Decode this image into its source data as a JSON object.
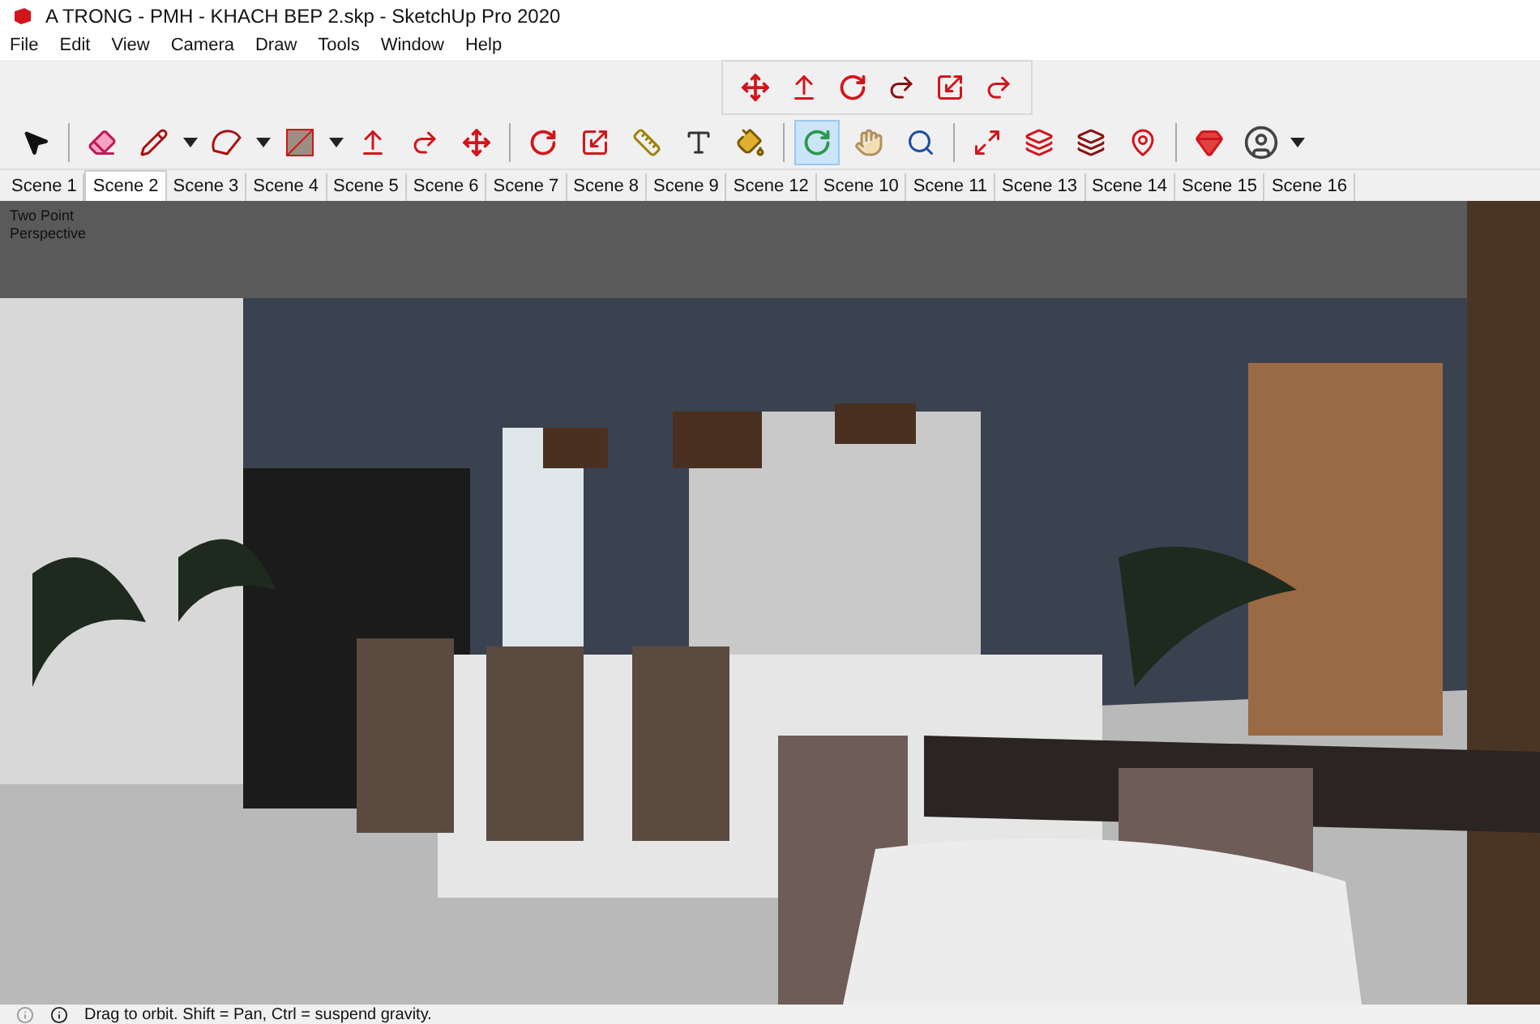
{
  "window": {
    "title": "A TRONG - PMH - KHACH BEP 2.skp - SketchUp Pro 2020"
  },
  "menu": [
    "File",
    "Edit",
    "View",
    "Camera",
    "Draw",
    "Tools",
    "Window",
    "Help"
  ],
  "floating_toolbar": [
    {
      "selected": false
    },
    {
      "selected": false
    },
    {
      "selected": false
    },
    {
      "selected": false
    },
    {
      "selected": false
    },
    {
      "selected": false
    }
  ],
  "main_toolbar": [
    {
      "selected": false
    },
    {
      "selected": false
    },
    {
      "selected": false
    },
    {
      "selected": false
    },
    {
      "selected": false
    },
    {
      "selected": false
    },
    {
      "selected": false
    },
    {
      "selected": false
    },
    {
      "selected": false
    },
    {
      "selected": false
    },
    {
      "selected": false
    },
    {
      "selected": false
    },
    {
      "selected": false
    },
    {
      "selected": true
    },
    {
      "selected": false
    },
    {
      "selected": false
    },
    {
      "selected": false
    },
    {
      "selected": false
    },
    {
      "selected": false
    },
    {
      "selected": false
    },
    {
      "selected": false
    },
    {
      "selected": false
    }
  ],
  "scenes": [
    {
      "label": "Scene 1",
      "selected": false
    },
    {
      "label": "Scene 2",
      "selected": true
    },
    {
      "label": "Scene 3",
      "selected": false
    },
    {
      "label": "Scene 4",
      "selected": false
    },
    {
      "label": "Scene 5",
      "selected": false
    },
    {
      "label": "Scene 6",
      "selected": false
    },
    {
      "label": "Scene 7",
      "selected": false
    },
    {
      "label": "Scene 8",
      "selected": false
    },
    {
      "label": "Scene 9",
      "selected": false
    },
    {
      "label": "Scene 12",
      "selected": false
    },
    {
      "label": "Scene 10",
      "selected": false
    },
    {
      "label": "Scene 11",
      "selected": false
    },
    {
      "label": "Scene 13",
      "selected": false
    },
    {
      "label": "Scene 14",
      "selected": false
    },
    {
      "label": "Scene 15",
      "selected": false
    },
    {
      "label": "Scene 16",
      "selected": false
    }
  ],
  "viewport": {
    "camera_label": "Two Point Perspective"
  },
  "status_bar": {
    "text": "Drag to orbit. Shift = Pan, Ctrl = suspend gravity."
  }
}
